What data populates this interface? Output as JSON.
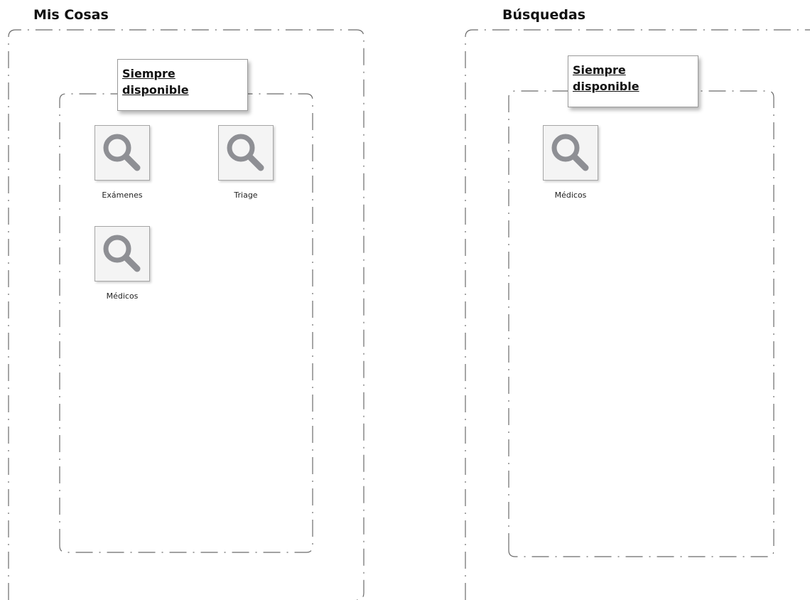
{
  "mis_cosas": {
    "title": "Mis Cosas",
    "group": {
      "label_line1": "Siempre",
      "label_line2": "disponible",
      "items": [
        {
          "label": "Exámenes",
          "icon": "search-icon"
        },
        {
          "label": "Triage",
          "icon": "search-icon"
        },
        {
          "label": "Médicos",
          "icon": "search-icon"
        }
      ]
    }
  },
  "busquedas": {
    "title": "Búsquedas",
    "group": {
      "label_line1": "Siempre",
      "label_line2": "disponible",
      "items": [
        {
          "label": "Médicos",
          "icon": "search-icon"
        }
      ]
    }
  },
  "colors": {
    "icon_gray": "#8e8f94",
    "frame_line": "#6b6b6b",
    "tile_background": "#f4f4f4"
  }
}
